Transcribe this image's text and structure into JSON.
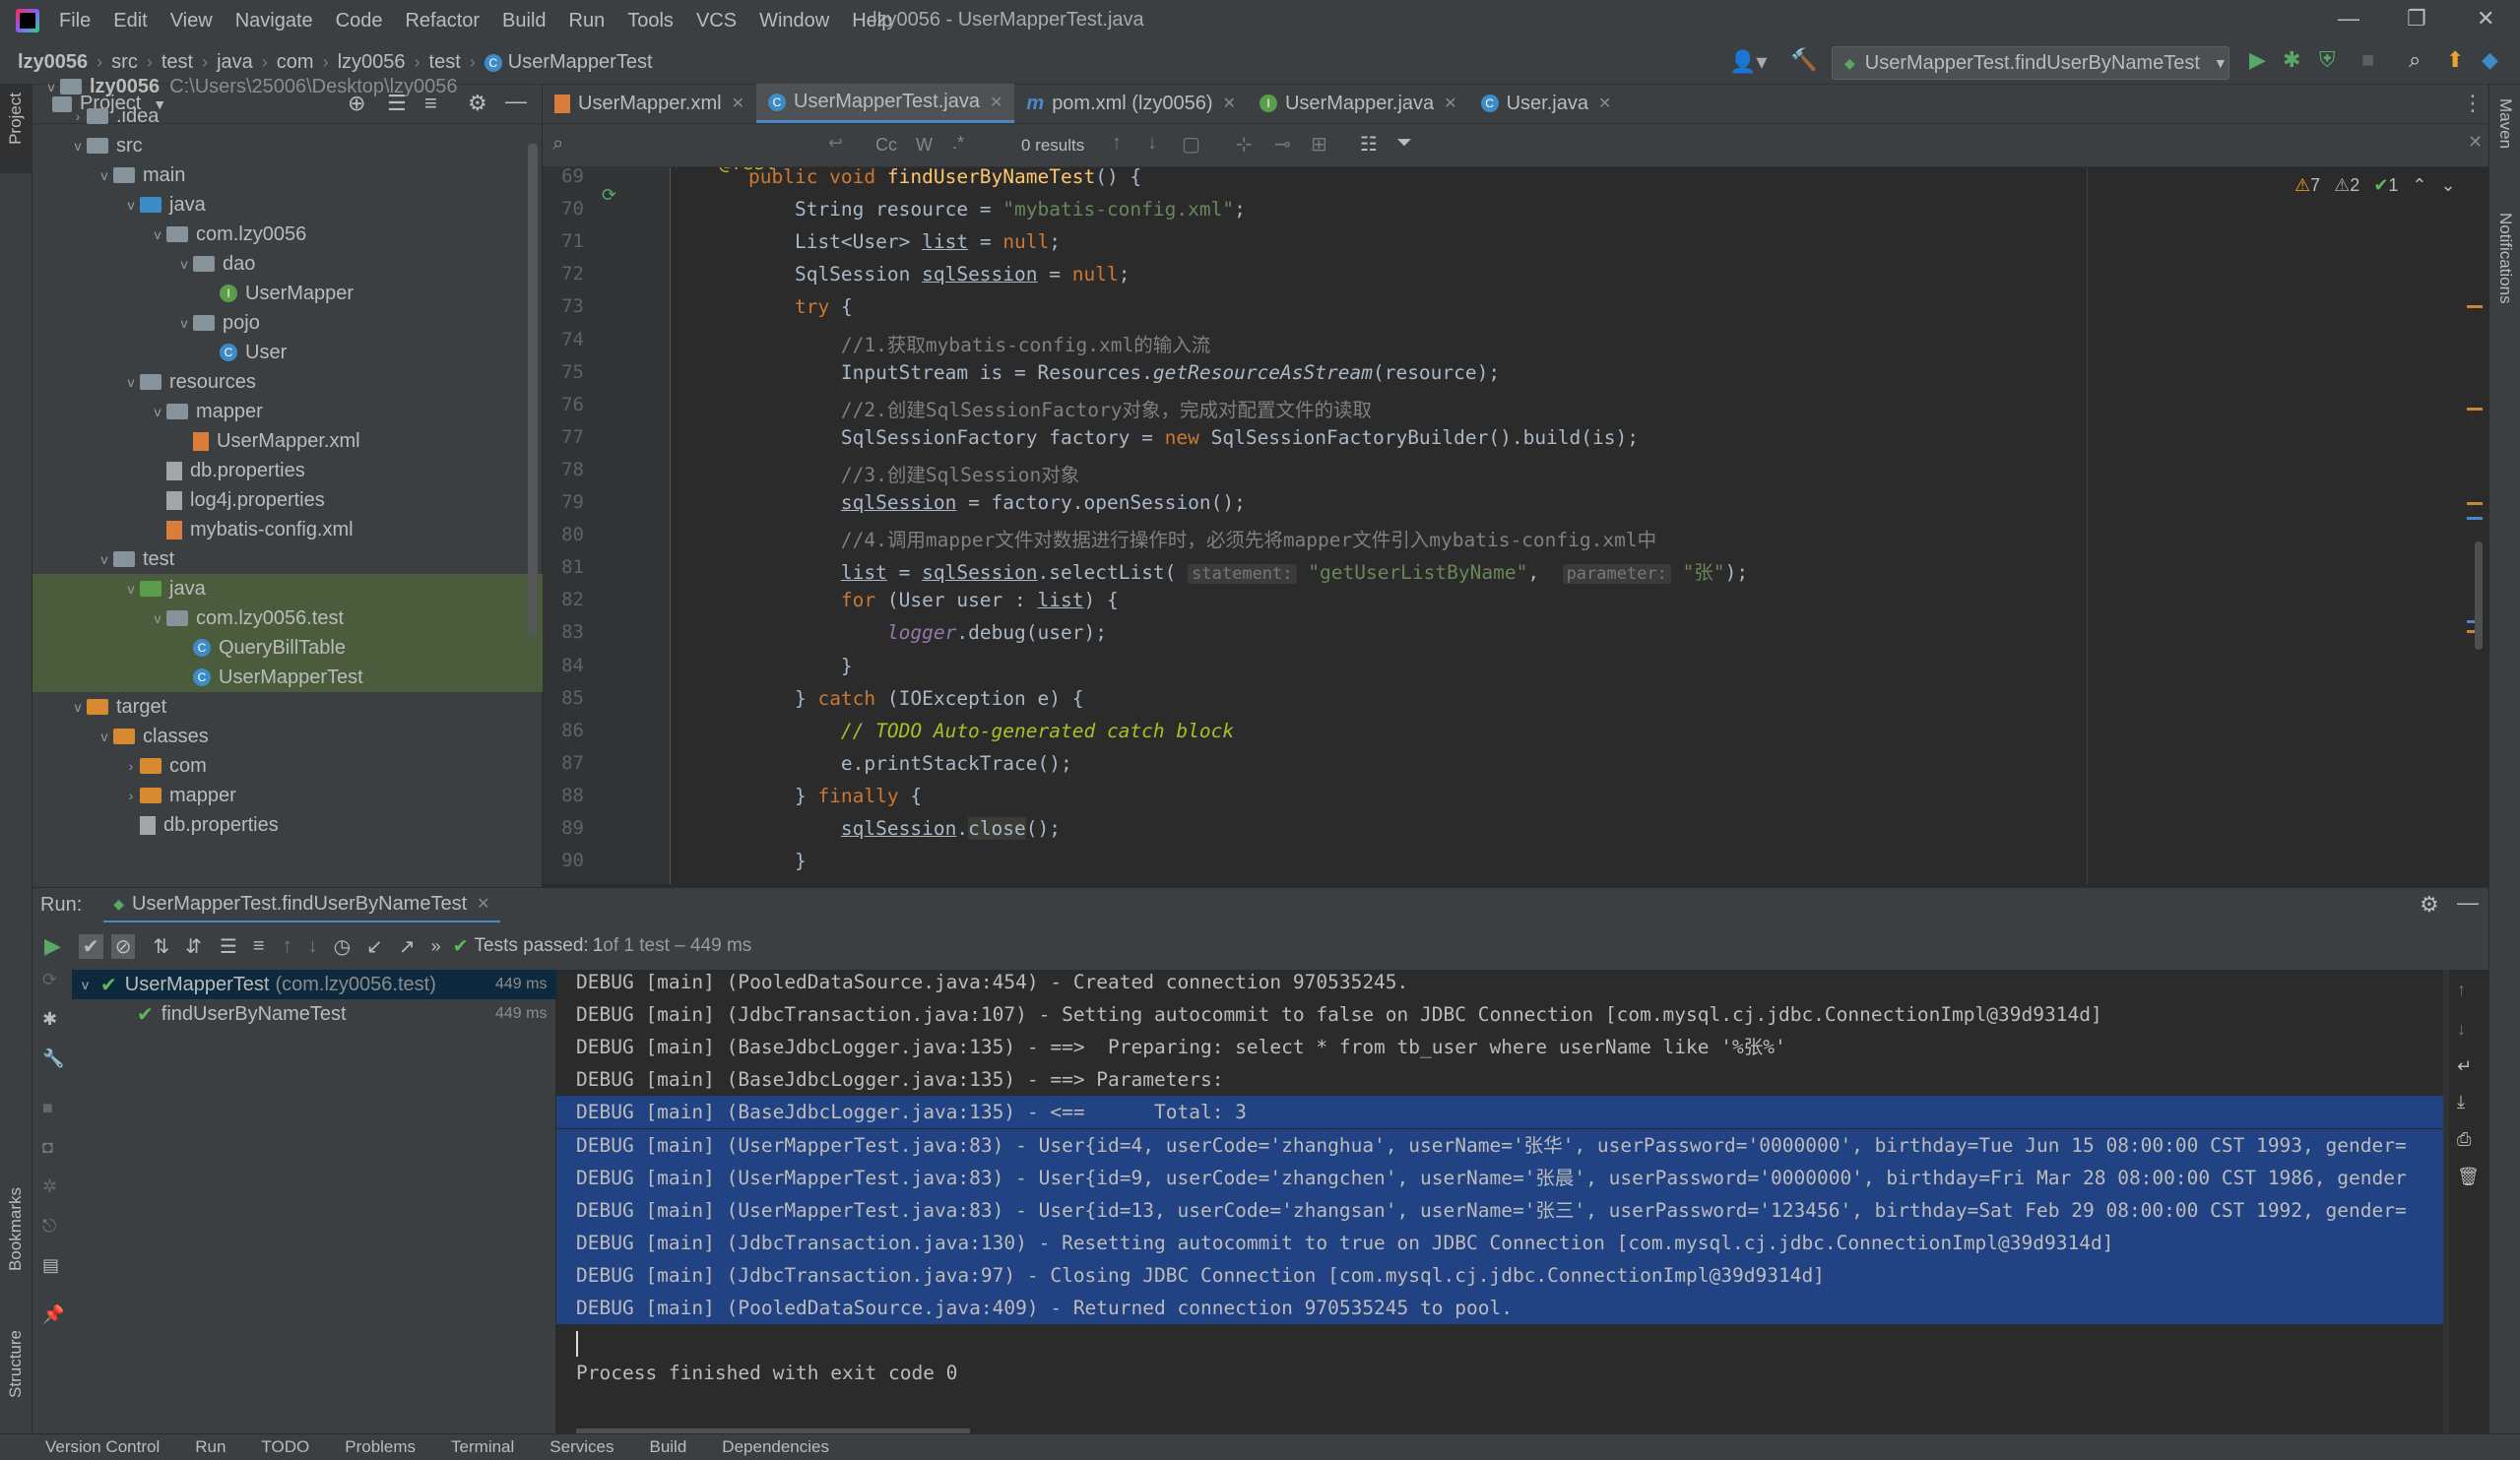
{
  "app": {
    "title": "lzy0056 - UserMapperTest.java"
  },
  "menu": [
    "File",
    "Edit",
    "View",
    "Navigate",
    "Code",
    "Refactor",
    "Build",
    "Run",
    "Tools",
    "VCS",
    "Window",
    "Help"
  ],
  "breadcrumb": [
    "lzy0056",
    "src",
    "test",
    "java",
    "com",
    "lzy0056",
    "test",
    "UserMapperTest"
  ],
  "run_config": "UserMapperTest.findUserByNameTest",
  "project": {
    "header": "Project",
    "tree": [
      {
        "label": "lzy0056",
        "sub": "C:\\Users\\25006\\Desktop\\lzy0056",
        "indent": 0,
        "arrow": "v",
        "icon": "folder"
      },
      {
        "label": ".idea",
        "indent": 1,
        "arrow": ">",
        "icon": "folder"
      },
      {
        "label": "src",
        "indent": 1,
        "arrow": "v",
        "icon": "folder"
      },
      {
        "label": "main",
        "indent": 2,
        "arrow": "v",
        "icon": "folder"
      },
      {
        "label": "java",
        "indent": 3,
        "arrow": "v",
        "icon": "folder-blue"
      },
      {
        "label": "com.lzy0056",
        "indent": 4,
        "arrow": "v",
        "icon": "folder"
      },
      {
        "label": "dao",
        "indent": 5,
        "arrow": "v",
        "icon": "folder"
      },
      {
        "label": "UserMapper",
        "indent": 6,
        "arrow": "",
        "icon": "iface"
      },
      {
        "label": "pojo",
        "indent": 5,
        "arrow": "v",
        "icon": "folder"
      },
      {
        "label": "User",
        "indent": 6,
        "arrow": "",
        "icon": "class"
      },
      {
        "label": "resources",
        "indent": 3,
        "arrow": "v",
        "icon": "folder-res"
      },
      {
        "label": "mapper",
        "indent": 4,
        "arrow": "v",
        "icon": "folder"
      },
      {
        "label": "UserMapper.xml",
        "indent": 5,
        "arrow": "",
        "icon": "xml"
      },
      {
        "label": "db.properties",
        "indent": 4,
        "arrow": "",
        "icon": "file"
      },
      {
        "label": "log4j.properties",
        "indent": 4,
        "arrow": "",
        "icon": "file"
      },
      {
        "label": "mybatis-config.xml",
        "indent": 4,
        "arrow": "",
        "icon": "xml"
      },
      {
        "label": "test",
        "indent": 2,
        "arrow": "v",
        "icon": "folder"
      },
      {
        "label": "java",
        "indent": 3,
        "arrow": "v",
        "icon": "folder-green",
        "sel": true
      },
      {
        "label": "com.lzy0056.test",
        "indent": 4,
        "arrow": "v",
        "icon": "folder",
        "sel": true
      },
      {
        "label": "QueryBillTable",
        "indent": 5,
        "arrow": "",
        "icon": "class",
        "sel": true
      },
      {
        "label": "UserMapperTest",
        "indent": 5,
        "arrow": "",
        "icon": "class",
        "sel": true
      },
      {
        "label": "target",
        "indent": 1,
        "arrow": "v",
        "icon": "folder-orange"
      },
      {
        "label": "classes",
        "indent": 2,
        "arrow": "v",
        "icon": "folder-orange"
      },
      {
        "label": "com",
        "indent": 3,
        "arrow": ">",
        "icon": "folder-orange"
      },
      {
        "label": "mapper",
        "indent": 3,
        "arrow": ">",
        "icon": "folder-orange"
      },
      {
        "label": "db.properties",
        "indent": 3,
        "arrow": "",
        "icon": "file"
      }
    ]
  },
  "tabs": [
    {
      "label": "UserMapper.xml",
      "icon": "xml"
    },
    {
      "label": "UserMapperTest.java",
      "icon": "class",
      "active": true
    },
    {
      "label": "pom.xml (lzy0056)",
      "icon": "maven"
    },
    {
      "label": "UserMapper.java",
      "icon": "iface"
    },
    {
      "label": "User.java",
      "icon": "class"
    }
  ],
  "find": {
    "results": "0 results",
    "cc": "Cc",
    "w": "W"
  },
  "inspections": {
    "warnings": "7",
    "weak": "2",
    "ok": "1"
  },
  "code": {
    "first_partial": "@Test",
    "lines": [
      {
        "n": "69",
        "html": "<span class='kw'>public void </span><span class='fn'>findUserByNameTest</span>() {"
      },
      {
        "n": "70",
        "html": "    String resource = <span class='str'>\"mybatis-config.xml\"</span>;"
      },
      {
        "n": "71",
        "html": "    List&lt;User&gt; <span class='ul'>list</span> = <span class='kw'>null</span>;"
      },
      {
        "n": "72",
        "html": "    SqlSession <span class='ul'>sqlSession</span> = <span class='kw'>null</span>;"
      },
      {
        "n": "73",
        "html": "    <span class='kw'>try </span>{"
      },
      {
        "n": "74",
        "html": "        <span class='cm'>//1.获取mybatis-config.xml的输入流</span>"
      },
      {
        "n": "75",
        "html": "        InputStream is = Resources.<span class='it'>getResourceAsStream</span>(resource);"
      },
      {
        "n": "76",
        "html": "        <span class='cm'>//2.创建SqlSessionFactory对象，完成对配置文件的读取</span>"
      },
      {
        "n": "77",
        "html": "        SqlSessionFactory factory = <span class='kw'>new </span>SqlSessionFactoryBuilder().build(is);"
      },
      {
        "n": "78",
        "html": "        <span class='cm'>//3.创建SqlSession对象</span>"
      },
      {
        "n": "79",
        "html": "        <span class='ul'>sqlSession</span> = factory.openSession();"
      },
      {
        "n": "80",
        "html": "        <span class='cm'>//4.调用mapper文件对数据进行操作时，必须先将mapper文件引入mybatis-config.xml中</span>"
      },
      {
        "n": "81",
        "html": "        <span class='ul'>list</span> = <span class='ul'>sqlSession</span>.selectList( <span class='hint'>statement:</span> <span class='str'>\"getUserListByName\"</span>,  <span class='hint'>parameter:</span> <span class='str'>\"张\"</span>);"
      },
      {
        "n": "82",
        "html": "        <span class='kw'>for </span>(User user : <span class='ul'>list</span>) {"
      },
      {
        "n": "83",
        "html": "            <span class='field it'>logger</span>.debug(user);"
      },
      {
        "n": "84",
        "html": "        }"
      },
      {
        "n": "85",
        "html": "    } <span class='kw'>catch </span>(IOException e) {"
      },
      {
        "n": "86",
        "html": "        <span class='todo'>// TODO Auto-generated catch block</span>"
      },
      {
        "n": "87",
        "html": "        e.printStackTrace();"
      },
      {
        "n": "88",
        "html": "    } <span class='kw'>finally </span>{"
      },
      {
        "n": "89",
        "html": "        <span class='ul'>sqlSession</span>.<span style='background:#3b3b36'>close</span>();"
      },
      {
        "n": "90",
        "html": "    }"
      }
    ]
  },
  "run": {
    "label": "Run:",
    "tab": "UserMapperTest.findUserByNameTest",
    "tests_passed": "Tests passed: ",
    "tests_count": "1",
    "tests_rest": " of 1 test – 449 ms",
    "tree": [
      {
        "label": "UserMapperTest",
        "sub": "(com.lzy0056.test)",
        "time": "449 ms"
      },
      {
        "label": "findUserByNameTest",
        "time": "449 ms"
      }
    ],
    "console": [
      {
        "t": "DEBUG [main] (PooledDataSource.java:454) - Created connection 970535245."
      },
      {
        "t": "DEBUG [main] (JdbcTransaction.java:107) - Setting autocommit to false on JDBC Connection [com.mysql.cj.jdbc.ConnectionImpl@39d9314d]"
      },
      {
        "t": "DEBUG [main] (BaseJdbcLogger.java:135) - ==>  Preparing: select * from tb_user where userName like '%张%'"
      },
      {
        "t": "DEBUG [main] (BaseJdbcLogger.java:135) - ==> Parameters: "
      },
      {
        "t": "DEBUG [main] (BaseJdbcLogger.java:135) - <==      Total: 3",
        "hl": true
      },
      {
        "t": "DEBUG [main] (UserMapperTest.java:83) - User{id=4, userCode='zhanghua', userName='张华', userPassword='0000000', birthday=Tue Jun 15 08:00:00 CST 1993, gender=",
        "hl": true
      },
      {
        "t": "DEBUG [main] (UserMapperTest.java:83) - User{id=9, userCode='zhangchen', userName='张晨', userPassword='0000000', birthday=Fri Mar 28 08:00:00 CST 1986, gender",
        "hl": true
      },
      {
        "t": "DEBUG [main] (UserMapperTest.java:83) - User{id=13, userCode='zhangsan', userName='张三', userPassword='123456', birthday=Sat Feb 29 08:00:00 CST 1992, gender=",
        "hl": true
      },
      {
        "t": "DEBUG [main] (JdbcTransaction.java:130) - Resetting autocommit to true on JDBC Connection [com.mysql.cj.jdbc.ConnectionImpl@39d9314d]",
        "hl": true
      },
      {
        "t": "DEBUG [main] (JdbcTransaction.java:97) - Closing JDBC Connection [com.mysql.cj.jdbc.ConnectionImpl@39d9314d]",
        "hl": true
      },
      {
        "t": "DEBUG [main] (PooledDataSource.java:409) - Returned connection 970535245 to pool.",
        "hl": true
      },
      {
        "t": ""
      },
      {
        "t": "Process finished with exit code 0"
      }
    ]
  },
  "side": {
    "left_top": "Project",
    "left_bookmarks": "Bookmarks",
    "left_structure": "Structure",
    "right_maven": "Maven",
    "right_notifications": "Notifications"
  },
  "status": [
    "Version Control",
    "Run",
    "TODO",
    "Problems",
    "Terminal",
    "Services",
    "Build",
    "Dependencies"
  ]
}
